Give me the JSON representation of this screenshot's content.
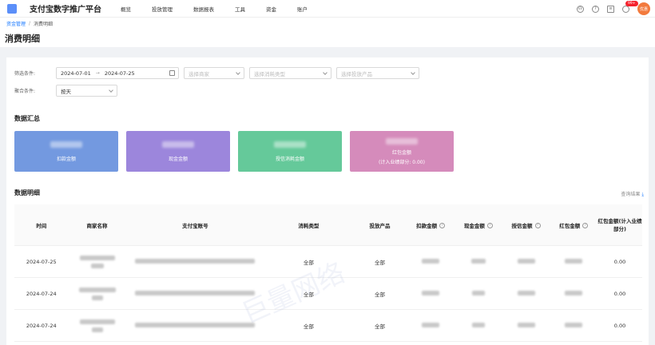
{
  "header": {
    "brand": "支付宝数字推广平台",
    "nav": [
      "概览",
      "投放管理",
      "数据报表",
      "工具",
      "资金",
      "账户"
    ],
    "badge": "99+",
    "avatar_text": "优惠"
  },
  "breadcrumb": {
    "parent": "资金管理",
    "current": "消费明细"
  },
  "page_title": "消费明细",
  "filters": {
    "filter_label": "筛选条件:",
    "date_start": "2024-07-01",
    "date_end": "2024-07-25",
    "merchant_placeholder": "选择商家",
    "consume_type_placeholder": "选择消耗类型",
    "product_placeholder": "选择投放产品",
    "group_label": "聚合条件:",
    "group_value": "按天"
  },
  "summary": {
    "title": "数据汇总",
    "cards": [
      {
        "label": "扣款金额",
        "color": "#7399e0"
      },
      {
        "label": "现金金额",
        "color": "#9c86dc"
      },
      {
        "label": "授信消耗金额",
        "color": "#65c99a"
      },
      {
        "label": "红包金额",
        "sub": "(计入业绩部分: 0.00)",
        "color": "#d58bbb"
      }
    ]
  },
  "detail": {
    "title": "数据明细",
    "export_label": "查询结果",
    "columns": [
      "时间",
      "商家名称",
      "支付宝账号",
      "消耗类型",
      "投放产品",
      "扣款金额",
      "现金金额",
      "授信金额",
      "红包金额",
      "红包金额(计入业绩部分)"
    ],
    "rows": [
      {
        "time": "2024-07-25",
        "type": "全部",
        "product": "全部",
        "hb_perf": "0.00"
      },
      {
        "time": "2024-07-24",
        "type": "全部",
        "product": "全部",
        "hb_perf": "0.00"
      },
      {
        "time": "2024-07-24",
        "type": "全部",
        "product": "全部",
        "hb_perf": "0.00"
      }
    ]
  },
  "watermark": "巨量网络"
}
